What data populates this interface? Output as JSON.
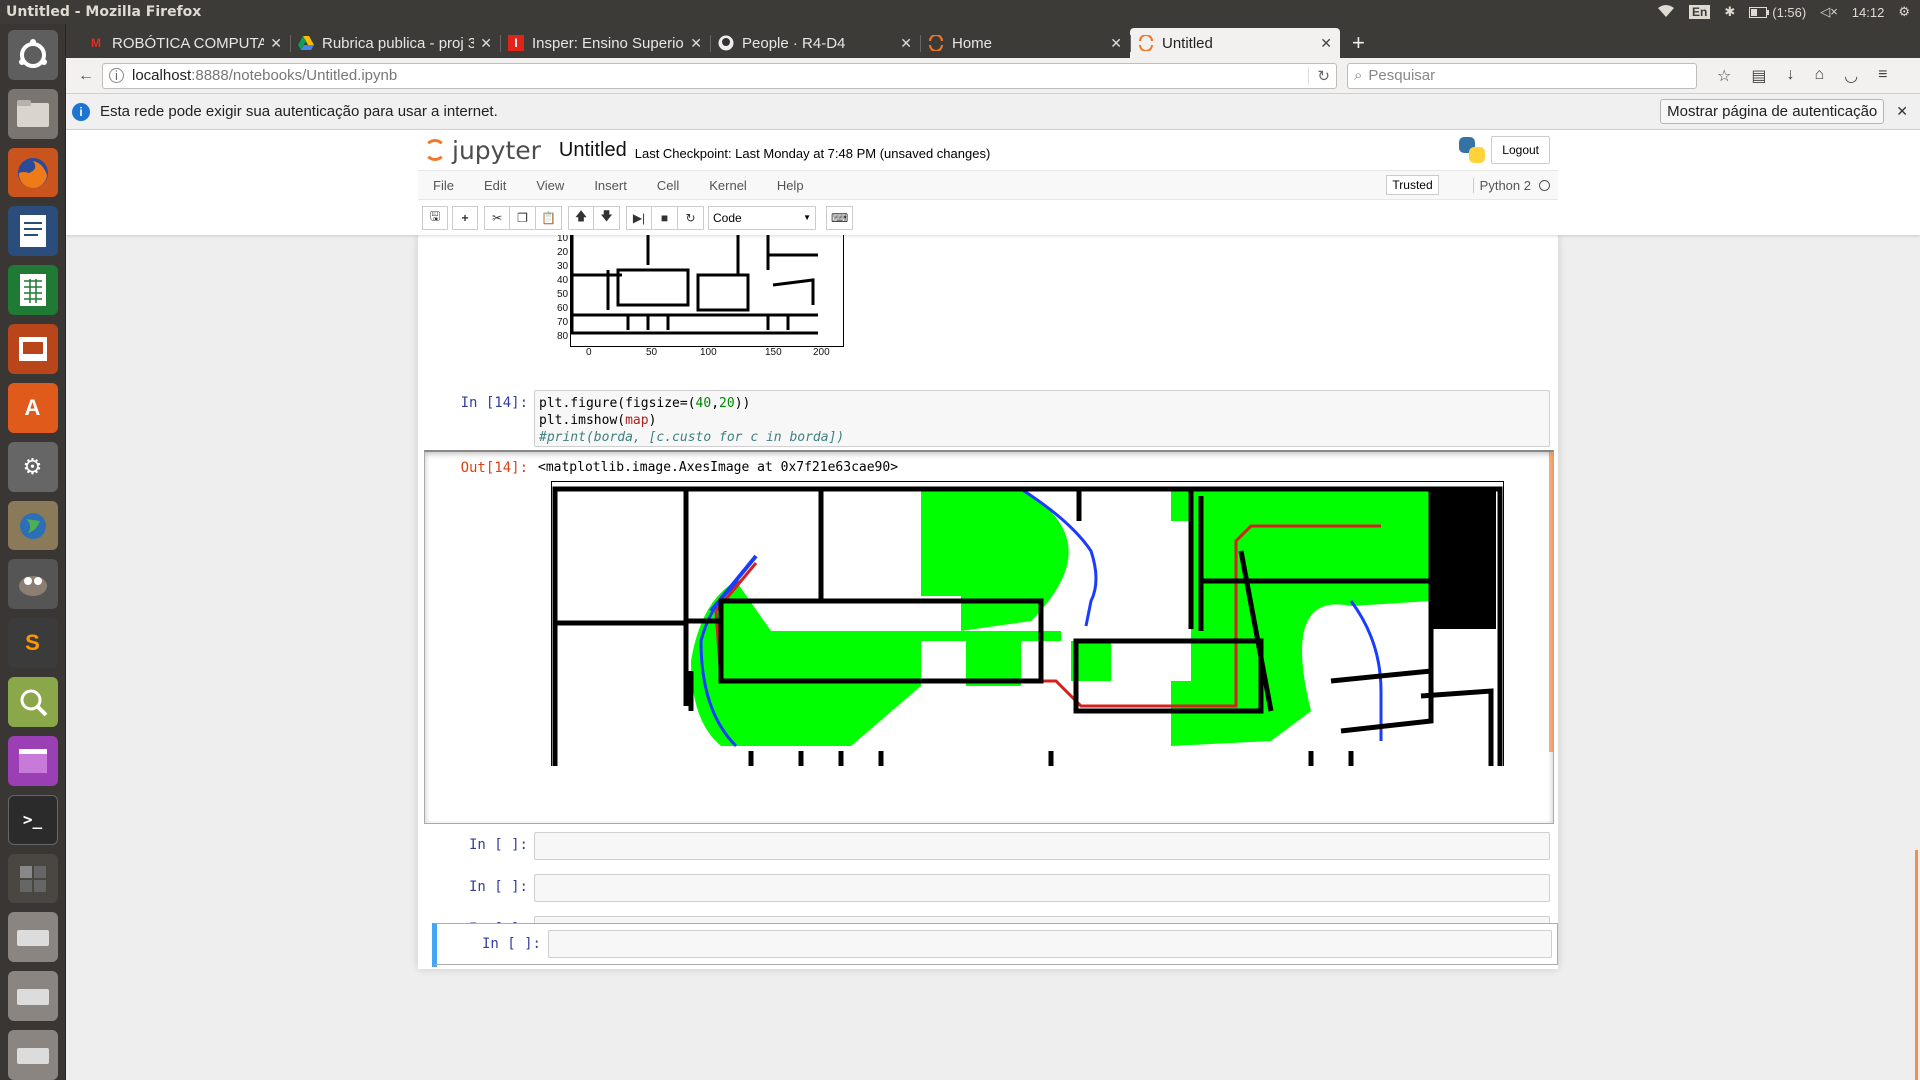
{
  "system": {
    "window_title": "Untitled - Mozilla Firefox",
    "keyboard_layout": "En",
    "battery": "(1:56)",
    "clock": "14:12"
  },
  "launcher": {
    "apps": [
      "ubuntu-dash",
      "files",
      "firefox",
      "writer",
      "calc",
      "impress",
      "software-center",
      "system-settings",
      "network",
      "gimp",
      "sublime-text",
      "image-viewer",
      "video",
      "terminal",
      "workspaces",
      "drive-1",
      "drive-2",
      "drive-3"
    ]
  },
  "browser": {
    "tabs": [
      {
        "label": "ROBÓTICA COMPUTAC",
        "icon": "gmail-icon"
      },
      {
        "label": "Rubrica publica - proj 3",
        "icon": "drive-icon"
      },
      {
        "label": "Insper: Ensino Superio",
        "icon": "insper-icon"
      },
      {
        "label": "People · R4-D4",
        "icon": "github-icon"
      },
      {
        "label": "Home",
        "icon": "jupyter-icon"
      },
      {
        "label": "Untitled",
        "icon": "jupyter-icon"
      }
    ],
    "url_host": "localhost",
    "url_path": ":8888/notebooks/Untitled.ipynb",
    "search_placeholder": "Pesquisar",
    "notification": "Esta rede pode exigir sua autenticação para usar a internet.",
    "notification_button": "Mostrar página de autenticação"
  },
  "jupyter": {
    "logo_text": "jupyter",
    "notebook_name": "Untitled",
    "checkpoint": "Last Checkpoint: Last Monday at 7:48 PM (unsaved changes)",
    "logout": "Logout",
    "menu": [
      "File",
      "Edit",
      "View",
      "Insert",
      "Cell",
      "Kernel",
      "Help"
    ],
    "trusted": "Trusted",
    "kernel": "Python 2",
    "cell_type": "Code"
  },
  "cells": {
    "prev_plot": {
      "y_ticks": [
        "10",
        "20",
        "30",
        "40",
        "50",
        "60",
        "70",
        "80"
      ],
      "x_ticks": [
        "0",
        "50",
        "100",
        "150",
        "200"
      ]
    },
    "cell14": {
      "in_prompt": "In [14]:",
      "code_line1_a": "plt.figure(figsize=(",
      "code_line1_n1": "40",
      "code_line1_sep": ",",
      "code_line1_n2": "20",
      "code_line1_b": "))",
      "code_line2_a": "plt.imshow(",
      "code_line2_var": "map",
      "code_line2_b": ")",
      "code_line3": "#print(borda, [c.custo for c in borda])",
      "out_prompt": "Out[14]:",
      "out_text": "<matplotlib.image.AxesImage at 0x7f21e63cae90>"
    },
    "empty_prompt": "In [ ]:"
  },
  "colors": {
    "jupyter_orange": "#f37726",
    "prompt_in": "#303f9f",
    "prompt_out": "#d84315",
    "map_green": "#00ff00",
    "path_red": "#d42020",
    "frontier_blue": "#1a3cff",
    "selected_cell_bar": "#42a5f5"
  }
}
